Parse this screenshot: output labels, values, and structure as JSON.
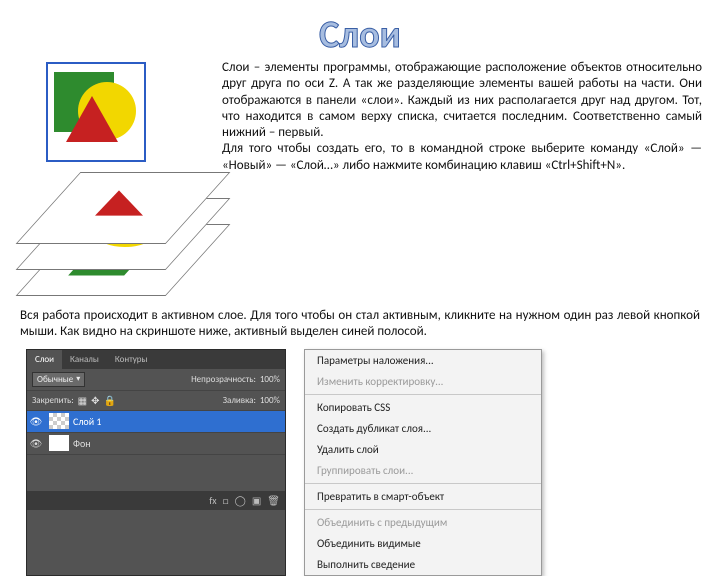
{
  "title": "Слои",
  "description": "Слои – элементы программы, отображающие расположение объектов относительно друг друга по оси Z. А так же разделяющие элементы вашей работы на части. Они отображаются в панели «слои». Каждый из них располагается друг над другом. Тот, что находится в самом верху списка, считается последним. Соответственно самый нижний – первый.\nДля того чтобы создать его, то в командной строке выберите команду «Слой» — «Новый» — «Слой…» либо нажмите комбинацию клавиш «Ctrl+Shift+N».",
  "mid_paragraph": "Вся работа происходит в активном слое. Для того чтобы он стал активным, кликните на нужном один раз левой кнопкой мыши. Как видно на скриншоте ниже, активный выделен синей полосой.",
  "layers_panel": {
    "tabs": [
      "Слои",
      "Каналы",
      "Контуры"
    ],
    "mode_label": "Обычные",
    "opacity_label": "Непрозрачность:",
    "opacity_value": "100%",
    "lock_label": "Закрепить:",
    "fill_label": "Заливка:",
    "fill_value": "100%",
    "rows": [
      {
        "name": "Слой 1",
        "selected": true,
        "checker": true
      },
      {
        "name": "Фон",
        "selected": false,
        "checker": false
      }
    ],
    "footer_icons": [
      "fx",
      "□",
      "◯",
      "▣",
      "🗑"
    ]
  },
  "context_menu": {
    "items": [
      {
        "label": "Параметры наложения...",
        "disabled": false
      },
      {
        "label": "Изменить корректировку...",
        "disabled": true
      },
      {
        "sep": true
      },
      {
        "label": "Копировать CSS",
        "disabled": false
      },
      {
        "label": "Создать дубликат слоя...",
        "disabled": false
      },
      {
        "label": "Удалить слой",
        "disabled": false
      },
      {
        "label": "Группировать слои...",
        "disabled": true
      },
      {
        "sep": true
      },
      {
        "label": "Превратить в смарт-объект",
        "disabled": false
      },
      {
        "sep": true
      },
      {
        "label": "Объединить с предыдущим",
        "disabled": true
      },
      {
        "label": "Объединить видимые",
        "disabled": false
      },
      {
        "label": "Выполнить сведение",
        "disabled": false
      }
    ]
  }
}
